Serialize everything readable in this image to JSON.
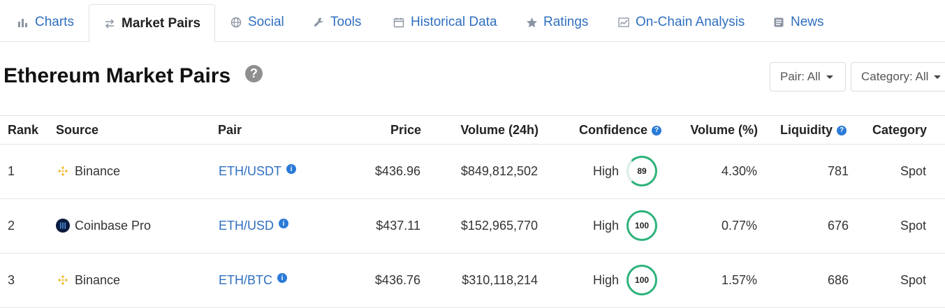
{
  "tabs": [
    {
      "label": "Charts",
      "icon": "bar-chart-icon"
    },
    {
      "label": "Market Pairs",
      "icon": "swap-arrows-icon",
      "active": true
    },
    {
      "label": "Social",
      "icon": "globe-icon"
    },
    {
      "label": "Tools",
      "icon": "wrench-icon"
    },
    {
      "label": "Historical Data",
      "icon": "calendar-icon"
    },
    {
      "label": "Ratings",
      "icon": "star-icon"
    },
    {
      "label": "On-Chain Analysis",
      "icon": "line-chart-icon"
    },
    {
      "label": "News",
      "icon": "newspaper-icon"
    }
  ],
  "page": {
    "title": "Ethereum Market Pairs",
    "help": "?"
  },
  "filters": {
    "pair": "Pair: All",
    "category": "Category: All"
  },
  "table": {
    "info_glyph": "?",
    "pair_info_glyph": "i",
    "headers": {
      "rank": "Rank",
      "source": "Source",
      "pair": "Pair",
      "price": "Price",
      "volume": "Volume (24h)",
      "confidence": "Confidence",
      "volume_pct": "Volume (%)",
      "liquidity": "Liquidity",
      "category": "Category"
    },
    "rows": [
      {
        "rank": "1",
        "source": "Binance",
        "source_icon": "binance-icon",
        "pair": "ETH/USDT",
        "price": "$436.96",
        "volume": "$849,812,502",
        "confidence": "High",
        "score": "89",
        "volume_pct": "4.30%",
        "liquidity": "781",
        "category": "Spot"
      },
      {
        "rank": "2",
        "source": "Coinbase Pro",
        "source_icon": "coinbase-icon",
        "pair": "ETH/USD",
        "price": "$437.11",
        "volume": "$152,965,770",
        "confidence": "High",
        "score": "100",
        "volume_pct": "0.77%",
        "liquidity": "676",
        "category": "Spot"
      },
      {
        "rank": "3",
        "source": "Binance",
        "source_icon": "binance-icon",
        "pair": "ETH/BTC",
        "price": "$436.76",
        "volume": "$310,118,214",
        "confidence": "High",
        "score": "100",
        "volume_pct": "1.57%",
        "liquidity": "686",
        "category": "Spot"
      }
    ]
  },
  "colors": {
    "link": "#2f6fc0",
    "confidence_ring": "#2eb27a",
    "info_badge": "#2a7ad8",
    "binance": "#f3ba2f",
    "coinbase": "#0b1b3d"
  }
}
